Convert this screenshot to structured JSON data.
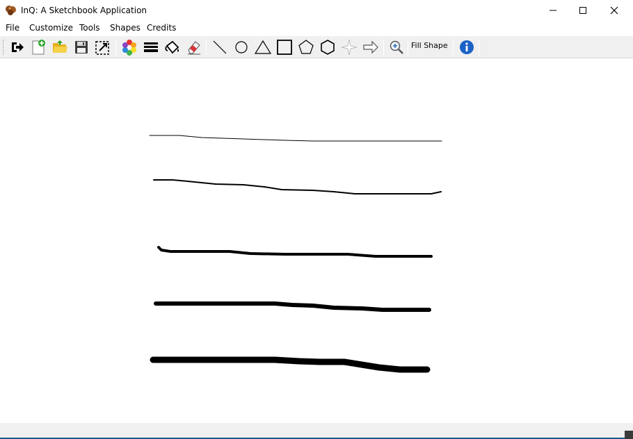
{
  "window": {
    "title": "InQ: A Sketchbook Application",
    "controls": [
      "minimize",
      "maximize",
      "close"
    ]
  },
  "menu": {
    "items": [
      "File",
      "Customize",
      "Tools",
      "Shapes",
      "Credits"
    ]
  },
  "toolbar": {
    "buttons": [
      "exit-icon",
      "new-file-icon",
      "open-folder-icon",
      "save-icon",
      "export-icon",
      "color-palette-icon",
      "line-width-icon",
      "fill-bucket-icon",
      "eraser-icon",
      "line-tool-icon",
      "circle-tool-icon",
      "triangle-tool-icon",
      "rectangle-tool-icon",
      "pentagon-tool-icon",
      "hexagon-tool-icon",
      "star-tool-icon",
      "arrow-tool-icon",
      "zoom-icon",
      "info-icon"
    ],
    "fill_shape_label": "Fill Shape"
  },
  "canvas": {
    "background": "#ffffff",
    "stroke_color": "#000000",
    "strokes": [
      {
        "width": 1
      },
      {
        "width": 2
      },
      {
        "width": 4
      },
      {
        "width": 6
      },
      {
        "width": 9
      }
    ]
  },
  "colors": {
    "toolbar_bg": "#f0f0f0",
    "status_line": "#1e5a8a"
  }
}
